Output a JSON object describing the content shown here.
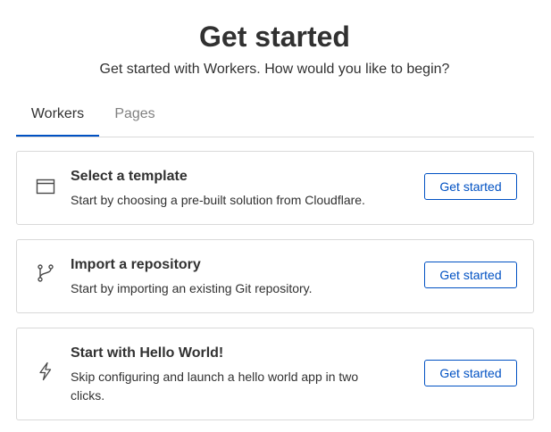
{
  "header": {
    "title": "Get started",
    "subtitle": "Get started with Workers. How would you like to begin?"
  },
  "tabs": [
    {
      "label": "Workers",
      "active": true
    },
    {
      "label": "Pages",
      "active": false
    }
  ],
  "cards": [
    {
      "icon": "browser-window-icon",
      "title": "Select a template",
      "description": "Start by choosing a pre-built solution from Cloudflare.",
      "button": "Get started"
    },
    {
      "icon": "git-branch-icon",
      "title": "Import a repository",
      "description": "Start by importing an existing Git repository.",
      "button": "Get started"
    },
    {
      "icon": "lightning-bolt-icon",
      "title": "Start with Hello World!",
      "description": "Skip configuring and launch a hello world app in two clicks.",
      "button": "Get started"
    }
  ],
  "colors": {
    "accent": "#0051c3",
    "text": "#313131",
    "muted": "#808080",
    "border": "#d9d9d9"
  }
}
